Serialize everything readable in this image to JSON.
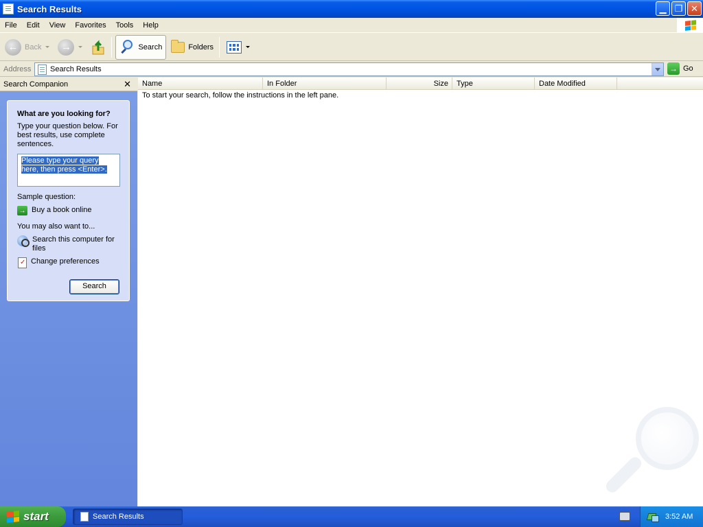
{
  "window": {
    "title": "Search Results",
    "controls": [
      "minimize",
      "restore",
      "close"
    ]
  },
  "menu": [
    "File",
    "Edit",
    "View",
    "Favorites",
    "Tools",
    "Help"
  ],
  "toolbar": {
    "back_label": "Back",
    "search_label": "Search",
    "folders_label": "Folders"
  },
  "address": {
    "label": "Address",
    "value": "Search Results",
    "go_label": "Go"
  },
  "companion": {
    "header": "Search Companion",
    "close_glyph": "✕",
    "heading": "What are you looking for?",
    "instructions": "Type your question below. For best results, use complete sentences.",
    "query_placeholder_line1": "Please type your query",
    "query_placeholder_line2": "here, then press <Enter>.",
    "sample_label": "Sample question:",
    "sample_link": "Buy a book online",
    "also_label": "You may also want to...",
    "link_search_computer": "Search this computer for files",
    "link_preferences": "Change preferences",
    "search_button": "Search"
  },
  "results": {
    "columns": [
      "Name",
      "In Folder",
      "Size",
      "Type",
      "Date Modified"
    ],
    "message": "To start your search, follow the instructions in the left pane."
  },
  "taskbar": {
    "start_label": "start",
    "task_label": "Search Results",
    "clock": "3:52 AM"
  },
  "colors": {
    "titlebar": "#0054e3",
    "start_button": "#3c9a3c",
    "left_pane": "#6d8fe0",
    "selection": "#316ac5"
  }
}
